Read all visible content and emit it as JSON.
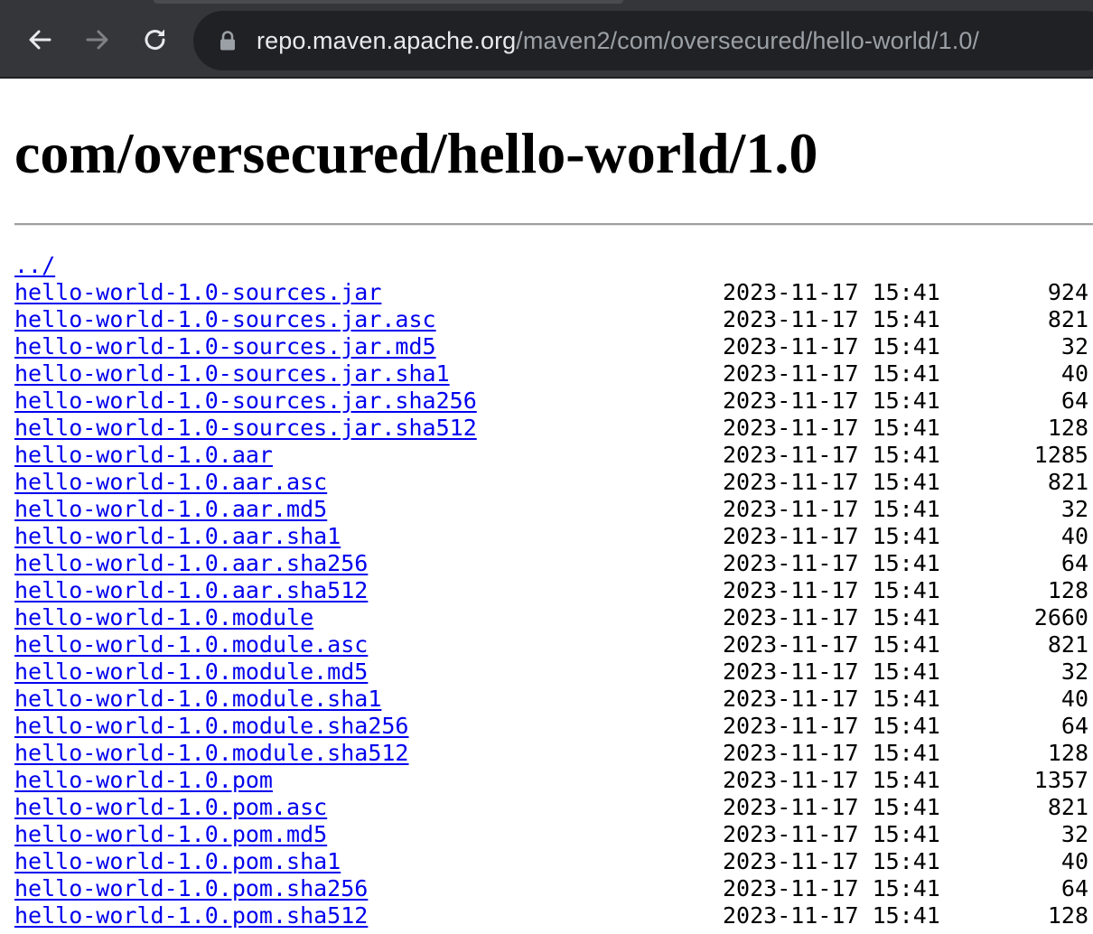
{
  "browser": {
    "url_host": "repo.maven.apache.org",
    "url_path": "/maven2/com/oversecured/hello-world/1.0/"
  },
  "page": {
    "title": "com/oversecured/hello-world/1.0",
    "parent_link": "../",
    "files": [
      {
        "name": "hello-world-1.0-sources.jar",
        "date": "2023-11-17 15:41",
        "size": "924"
      },
      {
        "name": "hello-world-1.0-sources.jar.asc",
        "date": "2023-11-17 15:41",
        "size": "821"
      },
      {
        "name": "hello-world-1.0-sources.jar.md5",
        "date": "2023-11-17 15:41",
        "size": "32"
      },
      {
        "name": "hello-world-1.0-sources.jar.sha1",
        "date": "2023-11-17 15:41",
        "size": "40"
      },
      {
        "name": "hello-world-1.0-sources.jar.sha256",
        "date": "2023-11-17 15:41",
        "size": "64"
      },
      {
        "name": "hello-world-1.0-sources.jar.sha512",
        "date": "2023-11-17 15:41",
        "size": "128"
      },
      {
        "name": "hello-world-1.0.aar",
        "date": "2023-11-17 15:41",
        "size": "1285"
      },
      {
        "name": "hello-world-1.0.aar.asc",
        "date": "2023-11-17 15:41",
        "size": "821"
      },
      {
        "name": "hello-world-1.0.aar.md5",
        "date": "2023-11-17 15:41",
        "size": "32"
      },
      {
        "name": "hello-world-1.0.aar.sha1",
        "date": "2023-11-17 15:41",
        "size": "40"
      },
      {
        "name": "hello-world-1.0.aar.sha256",
        "date": "2023-11-17 15:41",
        "size": "64"
      },
      {
        "name": "hello-world-1.0.aar.sha512",
        "date": "2023-11-17 15:41",
        "size": "128"
      },
      {
        "name": "hello-world-1.0.module",
        "date": "2023-11-17 15:41",
        "size": "2660"
      },
      {
        "name": "hello-world-1.0.module.asc",
        "date": "2023-11-17 15:41",
        "size": "821"
      },
      {
        "name": "hello-world-1.0.module.md5",
        "date": "2023-11-17 15:41",
        "size": "32"
      },
      {
        "name": "hello-world-1.0.module.sha1",
        "date": "2023-11-17 15:41",
        "size": "40"
      },
      {
        "name": "hello-world-1.0.module.sha256",
        "date": "2023-11-17 15:41",
        "size": "64"
      },
      {
        "name": "hello-world-1.0.module.sha512",
        "date": "2023-11-17 15:41",
        "size": "128"
      },
      {
        "name": "hello-world-1.0.pom",
        "date": "2023-11-17 15:41",
        "size": "1357"
      },
      {
        "name": "hello-world-1.0.pom.asc",
        "date": "2023-11-17 15:41",
        "size": "821"
      },
      {
        "name": "hello-world-1.0.pom.md5",
        "date": "2023-11-17 15:41",
        "size": "32"
      },
      {
        "name": "hello-world-1.0.pom.sha1",
        "date": "2023-11-17 15:41",
        "size": "40"
      },
      {
        "name": "hello-world-1.0.pom.sha256",
        "date": "2023-11-17 15:41",
        "size": "64"
      },
      {
        "name": "hello-world-1.0.pom.sha512",
        "date": "2023-11-17 15:41",
        "size": "128"
      }
    ]
  },
  "icons": {
    "back": "back-arrow-icon",
    "forward": "forward-arrow-icon",
    "reload": "reload-icon",
    "lock": "lock-icon"
  },
  "colors": {
    "toolbar": "#35363a",
    "omnibox": "#202124",
    "link": "#0000ee"
  }
}
